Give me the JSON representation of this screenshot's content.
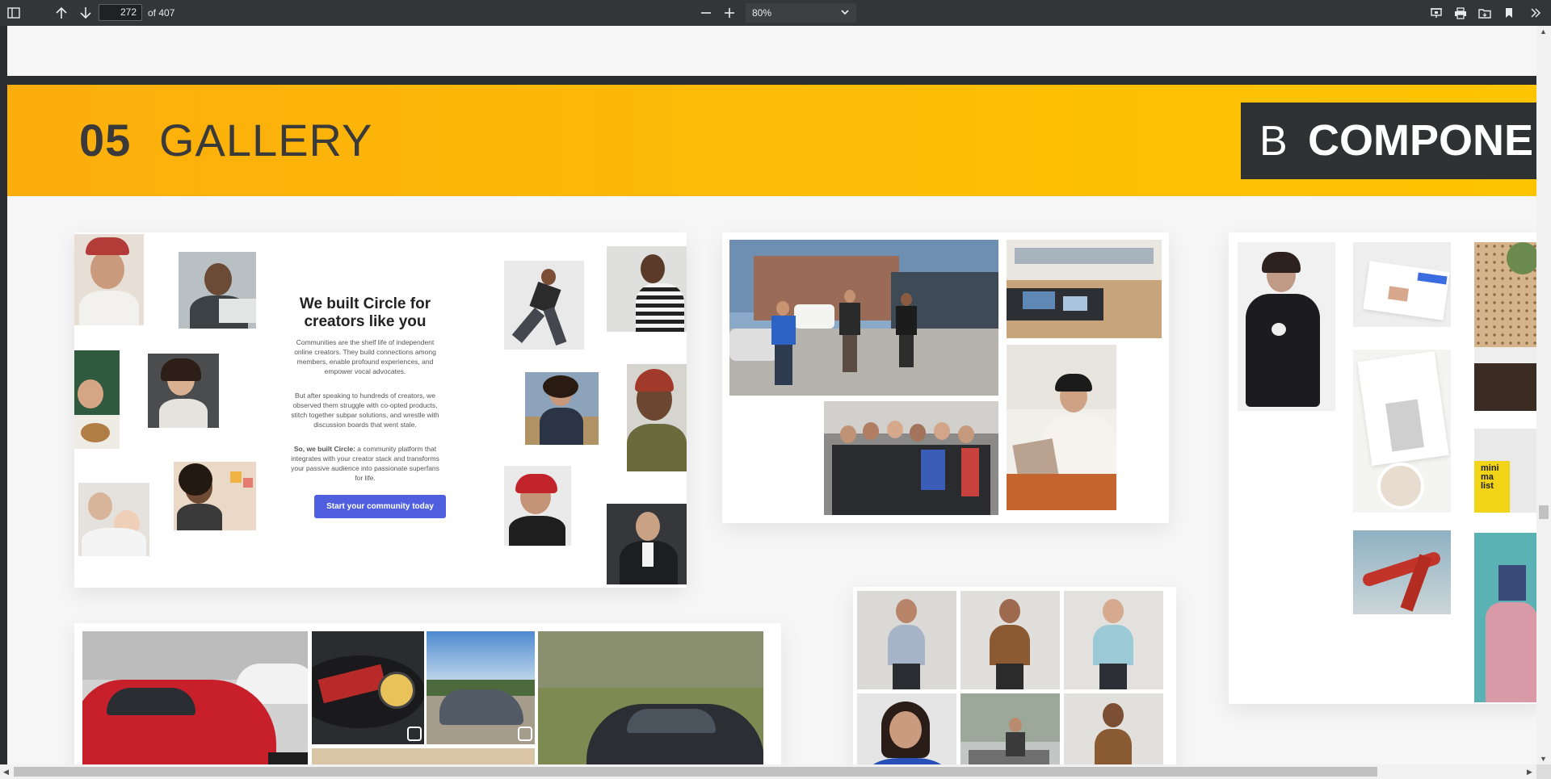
{
  "toolbar": {
    "sidebar_toggle_icon": "sidebar-icon",
    "page_current": "272",
    "page_total": "of 407",
    "zoom": "80%",
    "icons": [
      "previous-page-icon",
      "next-page-icon",
      "zoom-out-icon",
      "zoom-in-icon",
      "present-icon",
      "print-icon",
      "save-icon",
      "bookmark-icon",
      "more-icon"
    ]
  },
  "document": {
    "section_number": "05",
    "section_title": "GALLERY",
    "badge_letter": "B",
    "badge_text": "COMPONE",
    "circle_card": {
      "heading_line1": "We built Circle for",
      "heading_line2": "creators like you",
      "para1": "Communities are the shelf life of independent online creators. They build connections among members, enable profound experiences, and empower vocal advocates.",
      "para2": "But after speaking to hundreds of creators, we observed them struggle with co-opted products, stitch together subpar solutions, and wrestle with discussion boards that went stale.",
      "para3_bold": "So, we built Circle:",
      "para3_rest": " a community platform that integrates with your creator stack and transforms your passive audience into passionate superfans for life.",
      "button": "Start your community today"
    },
    "mini_book_text": "mini ma list"
  },
  "colors": {
    "banner": "#fdb80a",
    "badge": "#2f3133",
    "cta": "#4f5fe0",
    "toolbar": "#323639"
  }
}
